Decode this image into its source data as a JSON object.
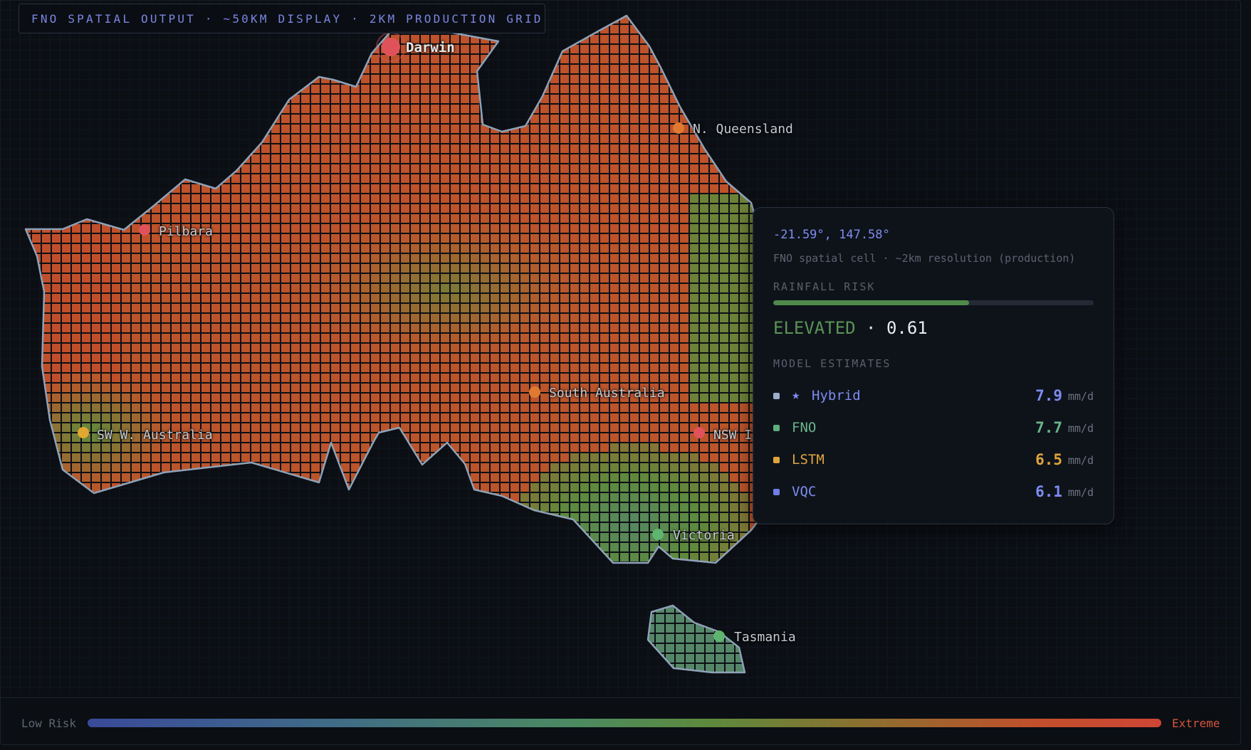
{
  "header": {
    "title": "FNO SPATIAL OUTPUT · ~50KM DISPLAY · 2KM PRODUCTION GRID"
  },
  "map": {
    "regions": [
      {
        "id": "darwin",
        "label": "Darwin",
        "color": "#e0525a",
        "emphasis": true
      },
      {
        "id": "n-queensland",
        "label": "N. Queensland",
        "color": "#e07a30"
      },
      {
        "id": "pilbara",
        "label": "Pilbara",
        "color": "#e0525a"
      },
      {
        "id": "south-australia",
        "label": "South Australia",
        "color": "#e07a30"
      },
      {
        "id": "sw-w-australia",
        "label": "SW W. Australia",
        "color": "#e0a830"
      },
      {
        "id": "nsw",
        "label": "NSW I",
        "color": "#e0525a"
      },
      {
        "id": "victoria",
        "label": "Victoria",
        "color": "#5fb56f"
      },
      {
        "id": "tasmania",
        "label": "Tasmania",
        "color": "#5fb56f"
      }
    ]
  },
  "tooltip": {
    "coords": "-21.59°, 147.58°",
    "subtitle": "FNO spatial cell · ~2km resolution (production)",
    "risk_section": "RAINFALL RISK",
    "risk_fraction": 0.61,
    "risk_level": "ELEVATED",
    "risk_sep": "·",
    "risk_score": "0.61",
    "estimates_section": "MODEL ESTIMATES",
    "estimates": [
      {
        "name": "Hybrid",
        "value": "7.9",
        "unit": "mm/d",
        "color": "#7e8cf0",
        "dot": "#9ab0cc",
        "starred": true
      },
      {
        "name": "FNO",
        "value": "7.7",
        "unit": "mm/d",
        "color": "#69b58a",
        "dot": "#5fae7e",
        "starred": false
      },
      {
        "name": "LSTM",
        "value": "6.5",
        "unit": "mm/d",
        "color": "#e0a43c",
        "dot": "#e0a43c",
        "starred": false
      },
      {
        "name": "VQC",
        "value": "6.1",
        "unit": "mm/d",
        "color": "#7e8cf0",
        "dot": "#6f7ee8",
        "starred": false
      }
    ]
  },
  "legend": {
    "low": "Low Risk",
    "high": "Extreme"
  },
  "colors": {
    "high": "#c34a2a",
    "mid": "#5d8a3c",
    "low": "#4a82a0",
    "outline": "#8ea2b8"
  }
}
